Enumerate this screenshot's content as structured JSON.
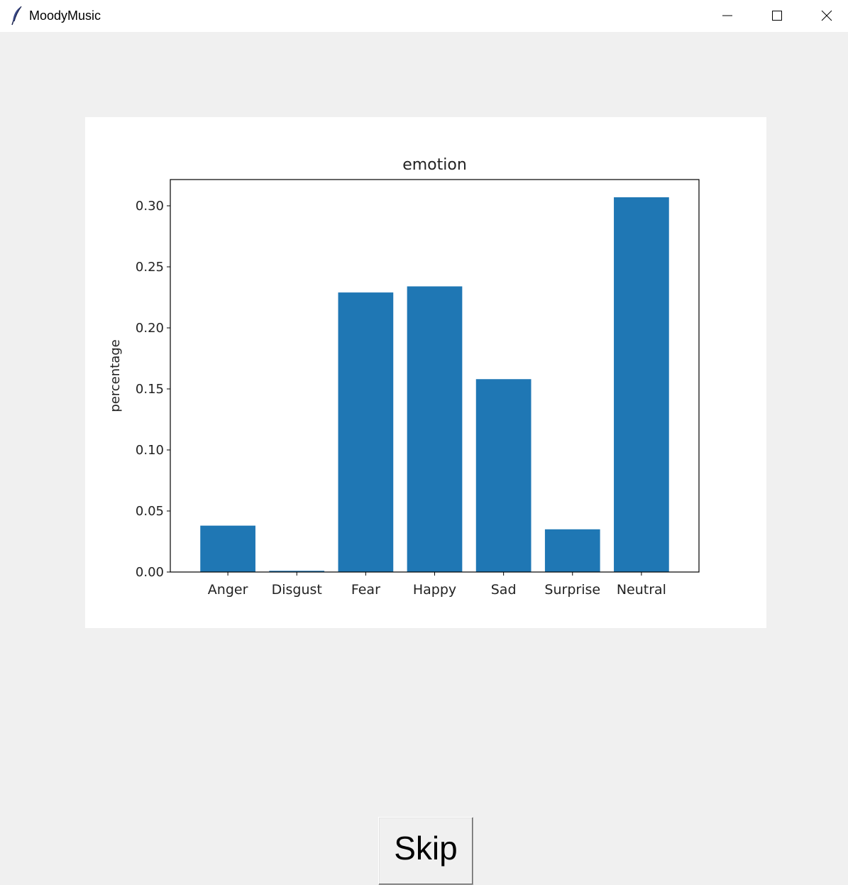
{
  "window": {
    "title": "MoodyMusic",
    "icon": "feather-icon",
    "controls": [
      "minimize-icon",
      "maximize-icon",
      "close-icon"
    ]
  },
  "chart_data": {
    "type": "bar",
    "title": "emotion",
    "xlabel": "",
    "ylabel": "percentage",
    "categories": [
      "Anger",
      "Disgust",
      "Fear",
      "Happy",
      "Sad",
      "Surprise",
      "Neutral"
    ],
    "values": [
      0.038,
      0.001,
      0.229,
      0.234,
      0.158,
      0.035,
      0.307
    ],
    "ylim": [
      0,
      0.3215
    ],
    "yticks": [
      0.0,
      0.05,
      0.1,
      0.15,
      0.2,
      0.25,
      0.3
    ],
    "ytick_labels": [
      "0.00",
      "0.05",
      "0.10",
      "0.15",
      "0.20",
      "0.25",
      "0.30"
    ],
    "bar_color": "#1f77b4",
    "grid": false
  },
  "skip_button": {
    "label": "Skip"
  }
}
